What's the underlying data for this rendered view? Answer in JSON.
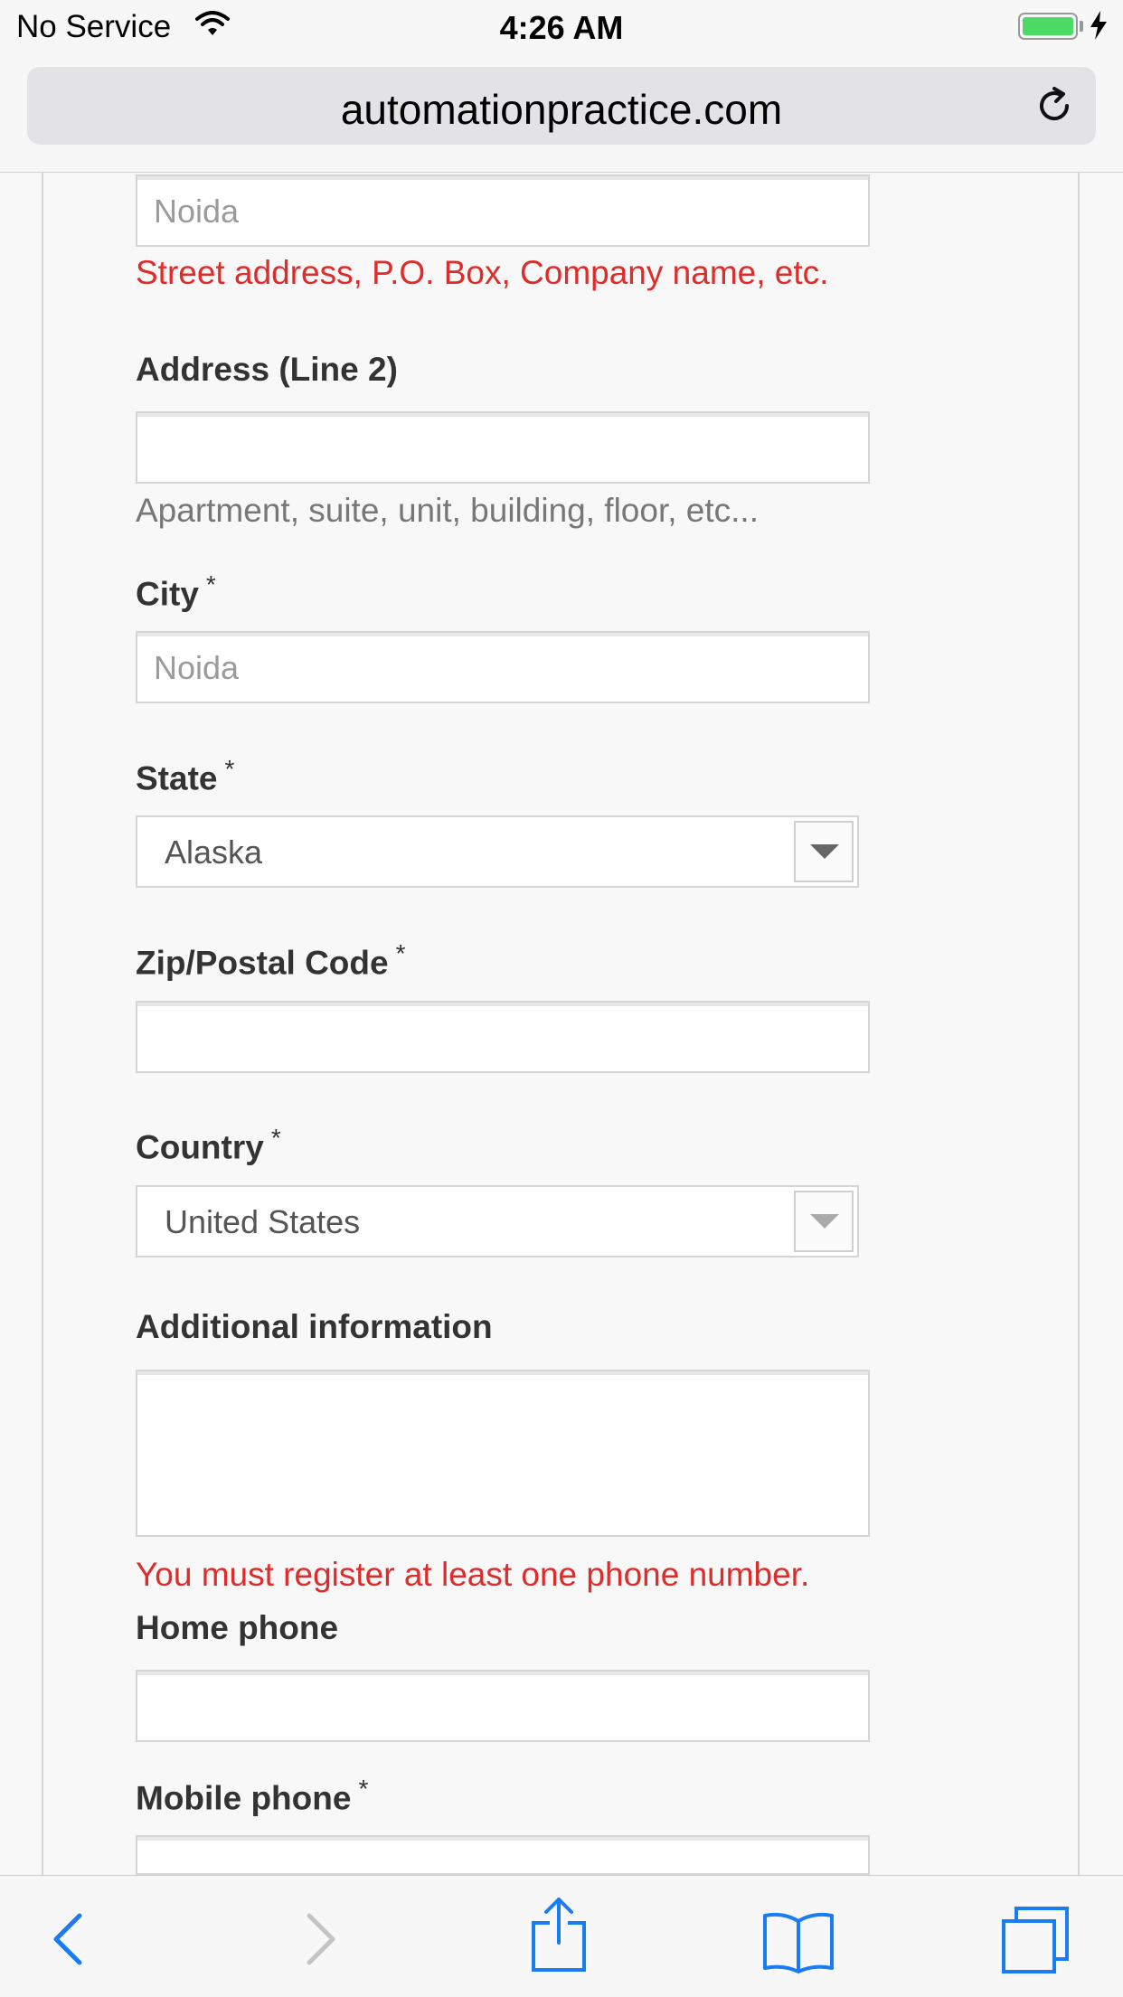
{
  "status_bar": {
    "carrier": "No Service",
    "time": "4:26 AM",
    "battery_level": 1.0
  },
  "browser": {
    "url": "automationpractice.com",
    "reload_icon": "reload-icon"
  },
  "form": {
    "address1": {
      "value": "Noida",
      "hint": "Street address, P.O. Box, Company name, etc."
    },
    "address2": {
      "label": "Address (Line 2)",
      "value": "",
      "hint": "Apartment, suite, unit, building, floor, etc..."
    },
    "city": {
      "label": "City",
      "required": "*",
      "value": "Noida"
    },
    "state": {
      "label": "State",
      "required": "*",
      "selected": "Alaska"
    },
    "zip": {
      "label": "Zip/Postal Code",
      "required": "*",
      "value": ""
    },
    "country": {
      "label": "Country",
      "required": "*",
      "selected": "United States"
    },
    "additional": {
      "label": "Additional information",
      "value": ""
    },
    "phone_error": "You must register at least one phone number.",
    "home_phone": {
      "label": "Home phone",
      "value": ""
    },
    "mobile_phone": {
      "label": "Mobile phone",
      "required": "*",
      "value": ""
    }
  },
  "toolbar": {
    "icons": [
      "back-icon",
      "forward-icon",
      "share-icon",
      "bookmarks-icon",
      "tabs-icon"
    ]
  },
  "colors": {
    "error": "#e02b2b",
    "ios_blue": "#1a7cf5",
    "battery": "#4cd964"
  }
}
